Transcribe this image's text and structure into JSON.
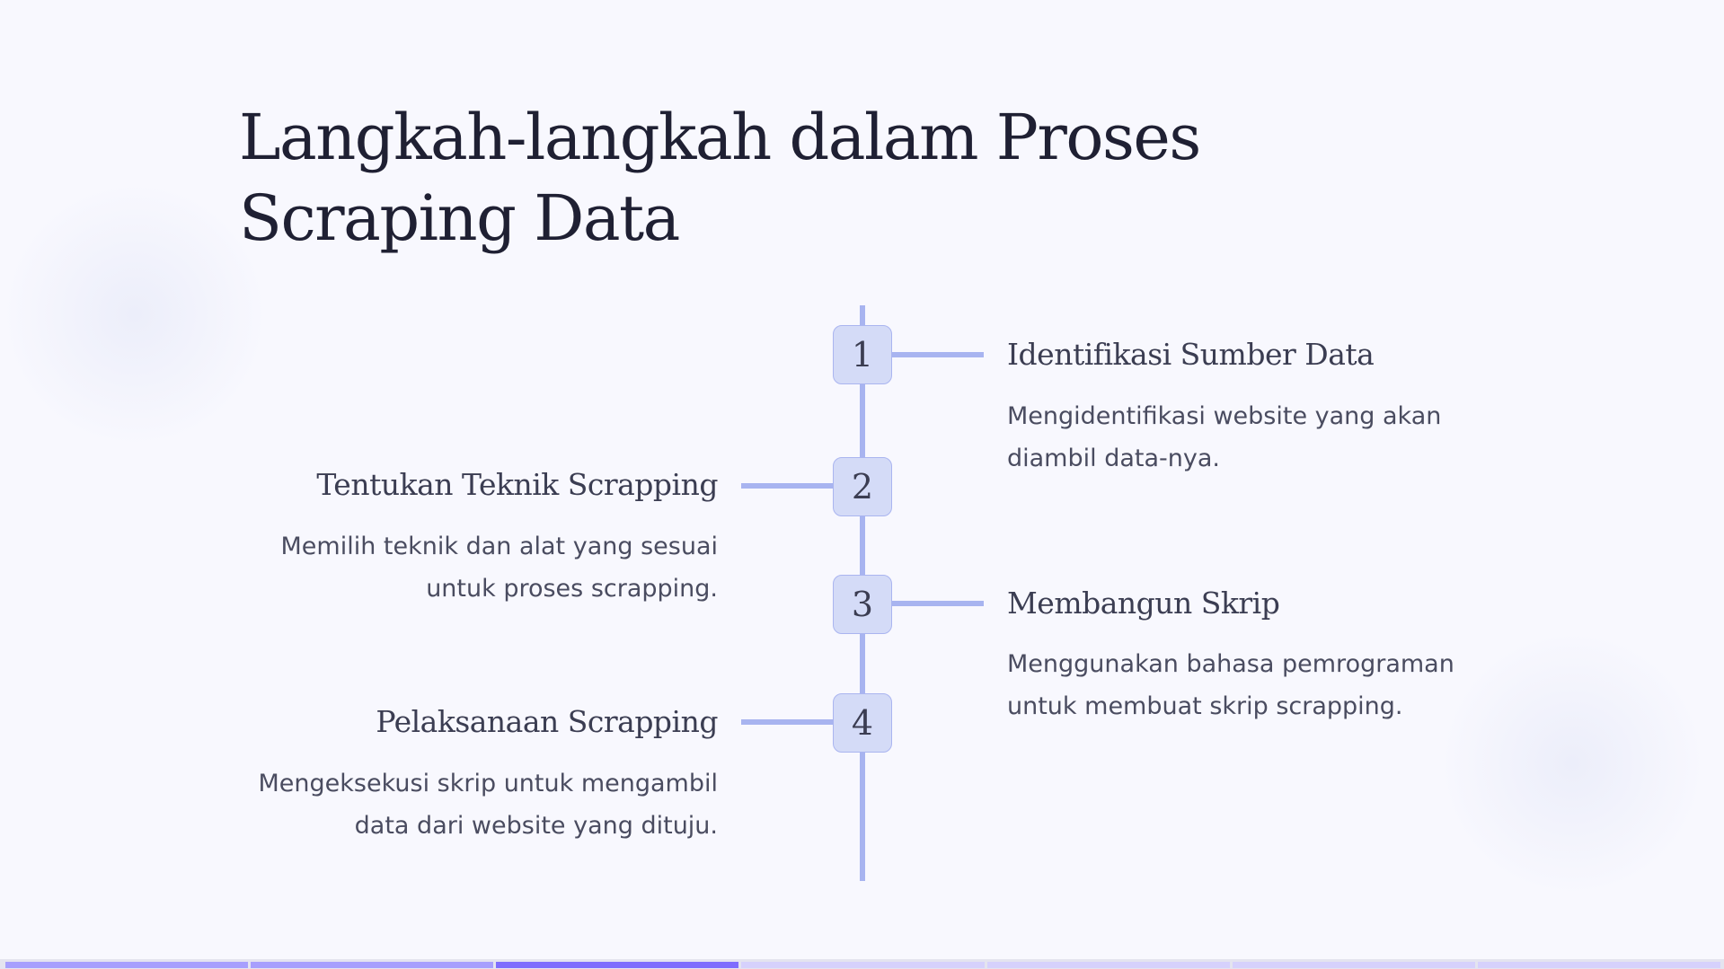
{
  "title": "Langkah-langkah dalam Proses Scraping Data",
  "steps": [
    {
      "number": "1",
      "heading": "Identifikasi Sumber Data",
      "body": "Mengidentifikasi website yang akan diambil data-nya."
    },
    {
      "number": "2",
      "heading": "Tentukan Teknik Scrapping",
      "body": "Memilih teknik dan alat yang sesuai untuk proses scrapping."
    },
    {
      "number": "3",
      "heading": "Membangun Skrip",
      "body": "Menggunakan bahasa pemrograman untuk membuat skrip scrapping."
    },
    {
      "number": "4",
      "heading": "Pelaksanaan Scrapping",
      "body": "Mengeksekusi skrip untuk mengambil data dari website yang dituju."
    }
  ],
  "progress": {
    "total_slides": 7,
    "current_slide": 3,
    "colors": {
      "done": "#a79ffd",
      "current": "#7f6dfd",
      "todo": "#d6d1fc"
    }
  }
}
